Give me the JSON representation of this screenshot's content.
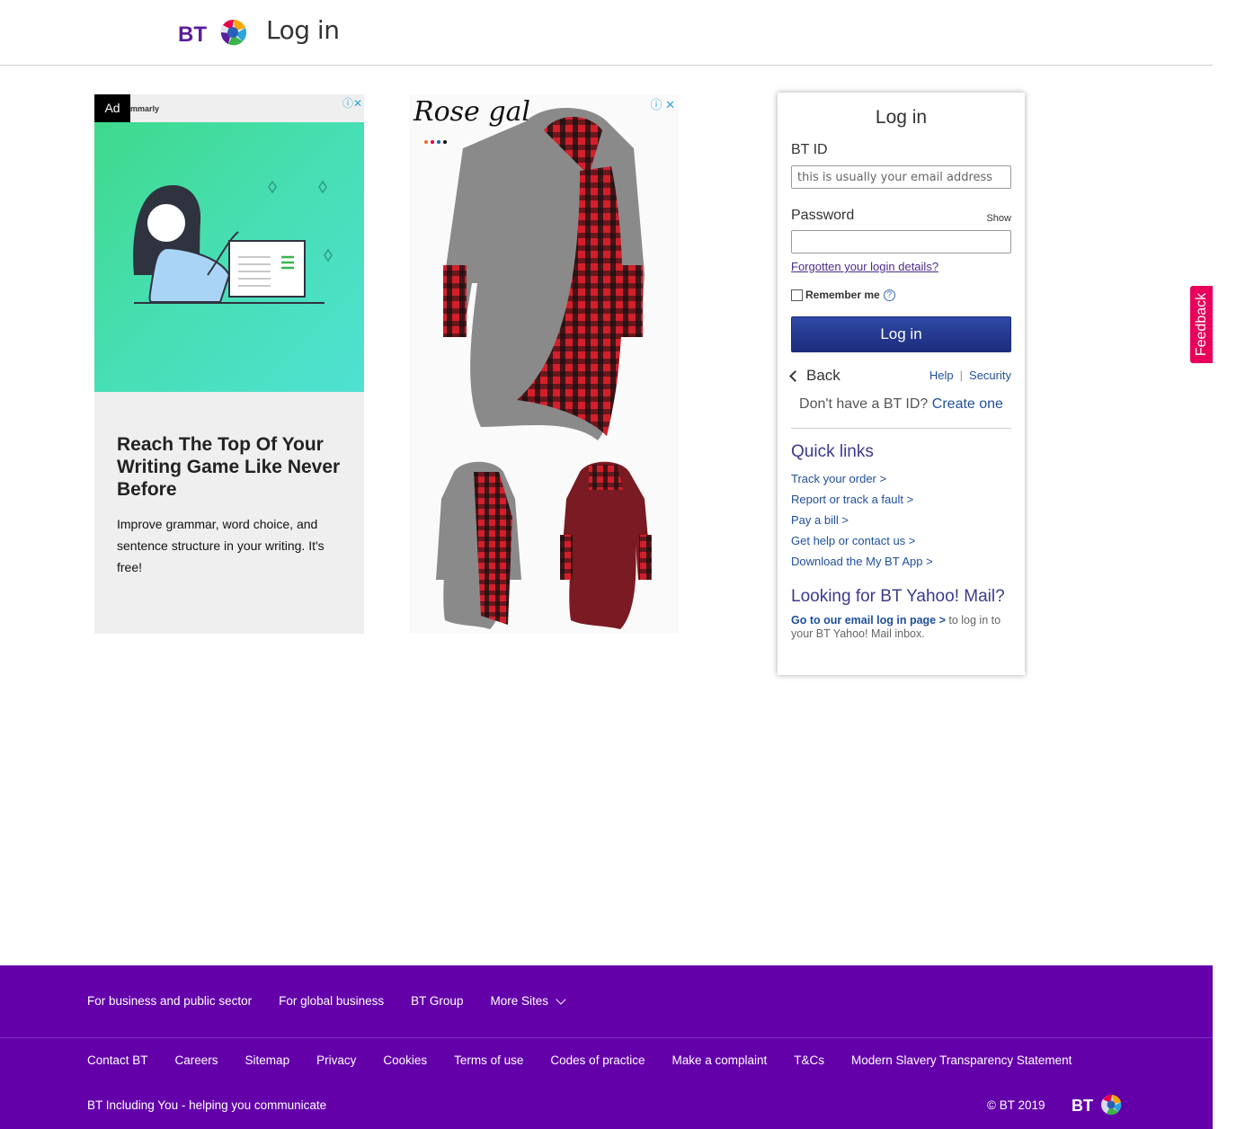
{
  "header": {
    "logo_text": "BT",
    "title": "Log in"
  },
  "ad1": {
    "label": "Ad",
    "advertiser": "mmarly",
    "icons": "ⓘ✕",
    "headline": "Reach The Top Of Your Writing Game Like Never Before",
    "body": "Improve grammar, word choice, and sentence structure in your writing. It's free!"
  },
  "ad2": {
    "brand": "Rose gal",
    "icons": "ⓘ ✕"
  },
  "login": {
    "title": "Log in",
    "bt_id_label": "BT ID",
    "bt_id_placeholder": "this is usually your email address",
    "password_label": "Password",
    "show_label": "Show",
    "password_value": "",
    "forgot_link": "Forgotten your login details?",
    "remember_label": "Remember me",
    "remember_help": "?",
    "login_button": "Log in",
    "back_label": "Back",
    "help_link": "Help",
    "security_link": "Security",
    "no_account_text": "Don't have a BT ID?",
    "create_link": "Create one",
    "quick_links_title": "Quick links",
    "quick_links": [
      "Track your order >",
      "Report or track a fault >",
      "Pay a bill >",
      "Get help or contact us >",
      "Download the My BT App >"
    ],
    "yahoo_title": "Looking for BT Yahoo! Mail?",
    "yahoo_link": "Go to our email log in page >",
    "yahoo_text": " to log in to your BT Yahoo! Mail inbox."
  },
  "feedback": {
    "label": "Feedback"
  },
  "footer": {
    "top_links": [
      "For business and public sector",
      "For global business",
      "BT Group"
    ],
    "more_sites": "More Sites",
    "bottom_links": [
      "Contact BT",
      "Careers",
      "Sitemap",
      "Privacy",
      "Cookies",
      "Terms of use",
      "Codes of practice",
      "Make a complaint",
      "T&Cs",
      "Modern Slavery Transparency Statement"
    ],
    "accessibility": "BT Including You - helping you communicate",
    "copyright": "© BT 2019",
    "logo_text": "BT"
  },
  "colors": {
    "footer_bg": "#6400aa",
    "login_button": "#1c2b7c",
    "feedback_bg": "#e8005a",
    "link": "#1f4f9c",
    "heading": "#3c3a8c"
  }
}
